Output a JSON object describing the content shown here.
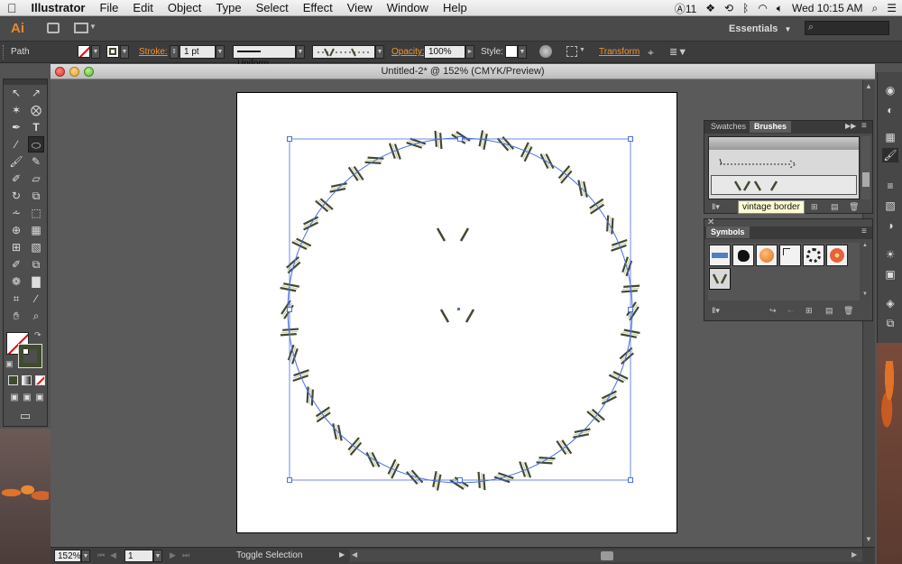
{
  "menubar": {
    "app_name": "Illustrator",
    "items": [
      "File",
      "Edit",
      "Object",
      "Type",
      "Select",
      "Effect",
      "View",
      "Window",
      "Help"
    ],
    "adobe_count": "11",
    "clock": "Wed 10:15 AM"
  },
  "appbar": {
    "logo": "Ai",
    "workspace": "Essentials"
  },
  "controlbar": {
    "selection_type": "Path",
    "stroke_label": "Stroke:",
    "stroke_weight": "1 pt",
    "profile": "Uniform",
    "opacity_label": "Opacity:",
    "opacity_value": "100%",
    "style_label": "Style:",
    "transform_label": "Transform"
  },
  "document": {
    "title": "Untitled-2* @ 152% (CMYK/Preview)"
  },
  "statusbar": {
    "zoom": "152%",
    "artboard_number": "1",
    "status_text": "Toggle Selection"
  },
  "brushes_panel": {
    "tabs": [
      "Swatches",
      "Brushes"
    ],
    "active_tab": "Brushes",
    "tooltip": "vintage border"
  },
  "symbols_panel": {
    "tab": "Symbols"
  },
  "colors": {
    "accent_orange": "#f0943a",
    "selection_blue": "#4a6fe0",
    "brush_stroke": "#3f4a2e"
  }
}
